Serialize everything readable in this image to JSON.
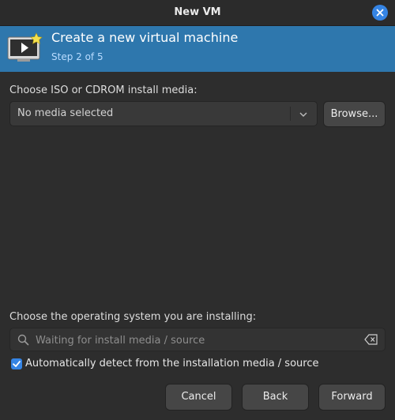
{
  "window": {
    "title": "New VM"
  },
  "header": {
    "title": "Create a new virtual machine",
    "step": "Step 2 of 5"
  },
  "install_media": {
    "label": "Choose ISO or CDROM install media:",
    "selected": "No media selected",
    "browse_label": "Browse..."
  },
  "os": {
    "label": "Choose the operating system you are installing:",
    "search_placeholder": "Waiting for install media / source",
    "auto_detect_label": "Automatically detect from the installation media / source",
    "auto_detect_checked": true
  },
  "footer": {
    "cancel": "Cancel",
    "back": "Back",
    "forward": "Forward"
  },
  "colors": {
    "accent": "#3584e4",
    "header_band": "#2e77ad",
    "background": "#2d2d2d"
  },
  "icons": [
    "close-icon",
    "vm-monitor-icon",
    "chevron-down-icon",
    "search-icon",
    "clear-text-icon",
    "checkmark-icon"
  ]
}
